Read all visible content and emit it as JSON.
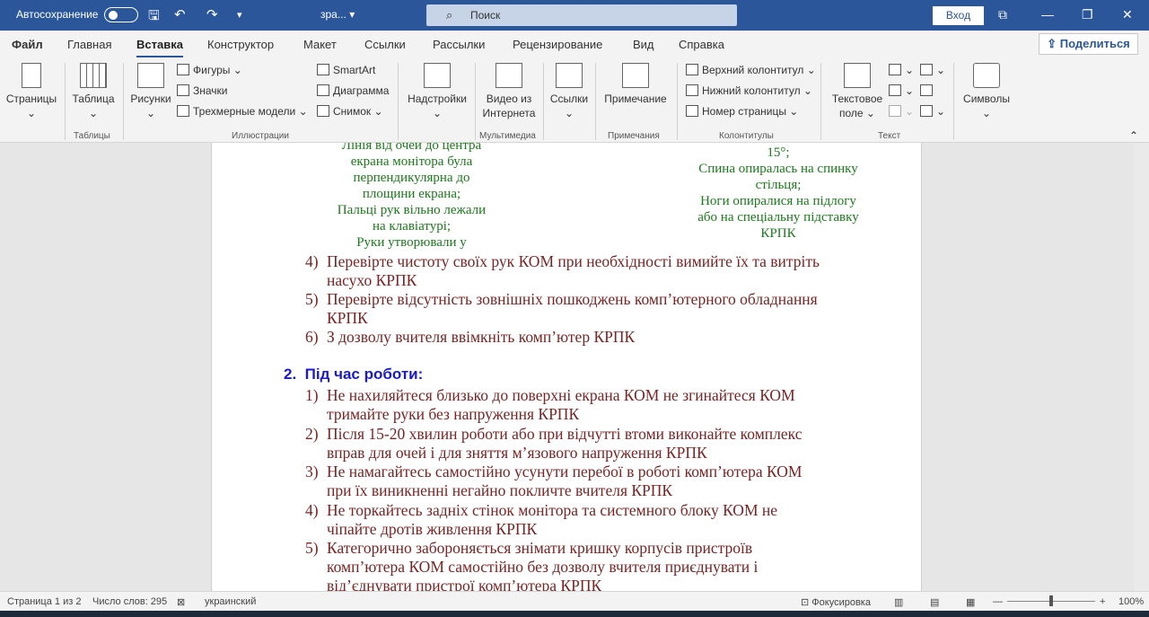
{
  "titlebar": {
    "autosave_label": "Автосохранение",
    "doc_name": "зра...",
    "search_placeholder": "Поиск",
    "signin_label": "Вход"
  },
  "tabs": {
    "items": [
      "Файл",
      "Главная",
      "Вставка",
      "Конструктор",
      "Макет",
      "Ссылки",
      "Рассылки",
      "Рецензирование",
      "Вид",
      "Справка"
    ],
    "active": "Вставка",
    "share_label": "Поделиться"
  },
  "ribbon": {
    "pages": "Страницы",
    "table": "Таблица",
    "group_tables": "Таблицы",
    "pictures": "Рисунки",
    "shapes": "Фигуры",
    "icons": "Значки",
    "models3d": "Трехмерные модели",
    "smartart": "SmartArt",
    "chart": "Диаграмма",
    "screenshot": "Снимок",
    "group_illustrations": "Иллюстрации",
    "addins": "Надстройки",
    "online_video_1": "Видео из",
    "online_video_2": "Интернета",
    "group_media": "Мультимедиа",
    "links": "Ссылки",
    "comment": "Примечание",
    "group_comments": "Примечания",
    "header": "Верхний колонтитул",
    "footer": "Нижний колонтитул",
    "page_number": "Номер страницы",
    "group_headerfooter": "Колонтитулы",
    "textbox_1": "Текстовое",
    "textbox_2": "поле",
    "group_text": "Текст",
    "symbols": "Символы"
  },
  "document": {
    "left_col": [
      "Лінія від очей до центра",
      "екрана монітора була",
      "перпендикулярна до",
      "площини екрана;",
      "Пальці рук вільно лежали",
      "на клавіатурі;",
      "Руки утворювали у"
    ],
    "right_col": [
      "15°;",
      "Спина опиралась на спинку",
      "стільця;",
      "Ноги опиралися на підлогу",
      "або на спеціальну підставку",
      "КРПК"
    ],
    "list_before": [
      {
        "num": "4)",
        "line1": "Перевірте чистоту своїх рук КОМ при необхідності вимийте їх та витріть",
        "line2": "насухо КРПК"
      },
      {
        "num": "5)",
        "line1": "Перевірте відсутність зовнішніх пошкоджень комп’ютерного обладнання",
        "line2": "КРПК"
      },
      {
        "num": "6)",
        "line1": "З дозволу вчителя ввімкніть комп’ютер КРПК",
        "line2": ""
      }
    ],
    "heading_num": "2.",
    "heading": "Під час роботи:",
    "list_during": [
      {
        "num": "1)",
        "line1": "Не нахиляйтеся близько до поверхні екрана КОМ не згинайтеся КОМ",
        "line2": "тримайте руки без напруження КРПК"
      },
      {
        "num": "2)",
        "line1": "Після 15-20 хвилин роботи або при відчутті втоми виконайте комплекс",
        "line2": "вправ для очей і для зняття м’язового напруження КРПК"
      },
      {
        "num": "3)",
        "line1": "Не намагайтесь самостійно усунути перебої в роботі комп’ютера КОМ",
        "line2": "при їх виникненні негайно покличте вчителя КРПК"
      },
      {
        "num": "4)",
        "line1": "Не торкайтесь задніх стінок монітора та системного блоку КОМ не",
        "line2": "чіпайте дротів живлення КРПК"
      },
      {
        "num": "5)",
        "line1": "Категорично забороняється знімати кришку корпусів пристроїв",
        "line2": "комп’ютера КОМ самостійно без дозволу вчителя приєднувати і",
        "line3": "від’єднувати пристрої комп’ютера КРПК"
      }
    ]
  },
  "status": {
    "page": "Страница 1 из 2",
    "words": "Число слов: 295",
    "language": "украинский",
    "focus": "Фокусировка",
    "zoom": "100%",
    "zoom_level": 0.5
  },
  "colors": {
    "brand": "#2b579a",
    "green_text": "#1b7a1b",
    "list_text": "#7a2424",
    "heading": "#1a1ac8"
  }
}
